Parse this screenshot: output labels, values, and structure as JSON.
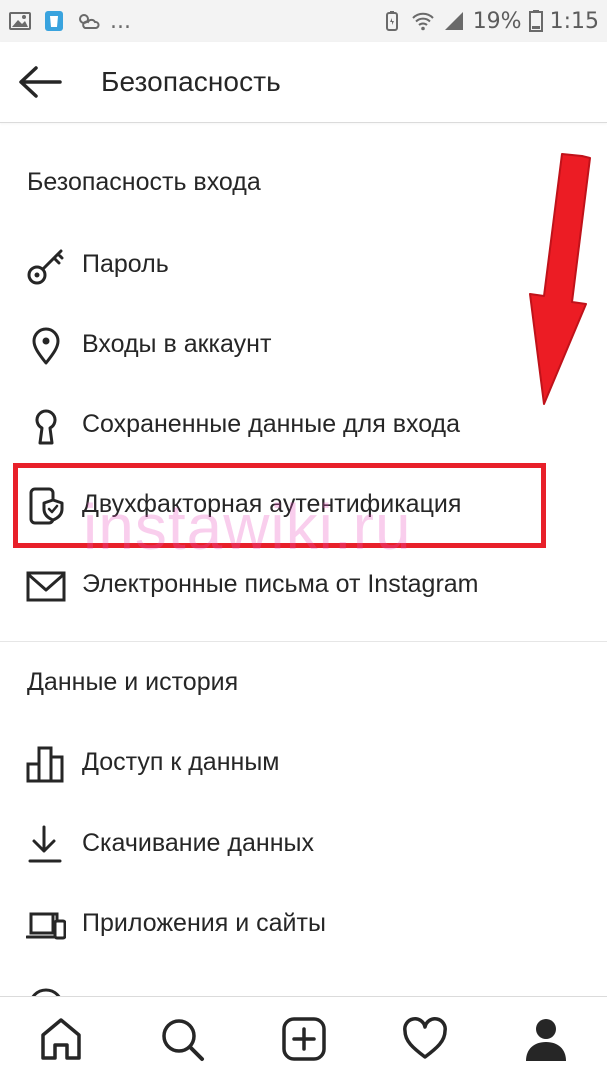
{
  "status_bar": {
    "battery_percent": "19%",
    "time": "1:15",
    "overflow": "..."
  },
  "header": {
    "title": "Безопасность"
  },
  "sections": [
    {
      "title": "Безопасность входа",
      "items": [
        {
          "label": "Пароль",
          "icon": "key-icon"
        },
        {
          "label": "Входы в аккаунт",
          "icon": "location-pin-icon"
        },
        {
          "label": "Сохраненные данные для входа",
          "icon": "keyhole-icon"
        },
        {
          "label": "Двухфакторная аутентификация",
          "icon": "phone-shield-icon",
          "highlighted": true
        },
        {
          "label": "Электронные письма от Instagram",
          "icon": "envelope-icon"
        }
      ]
    },
    {
      "title": "Данные и история",
      "items": [
        {
          "label": "Доступ к данным",
          "icon": "bar-chart-icon"
        },
        {
          "label": "Скачивание данных",
          "icon": "download-icon"
        },
        {
          "label": "Приложения и сайты",
          "icon": "devices-icon"
        }
      ]
    }
  ],
  "watermark": "instawiki.ru",
  "bottom_nav": [
    {
      "icon": "home-icon"
    },
    {
      "icon": "search-icon"
    },
    {
      "icon": "add-post-icon"
    },
    {
      "icon": "heart-icon"
    },
    {
      "icon": "profile-icon"
    }
  ],
  "colors": {
    "highlight": "#e8202a",
    "arrow": "#e8202a",
    "text": "#262626",
    "status_bar_bg": "#f3f3f3"
  }
}
